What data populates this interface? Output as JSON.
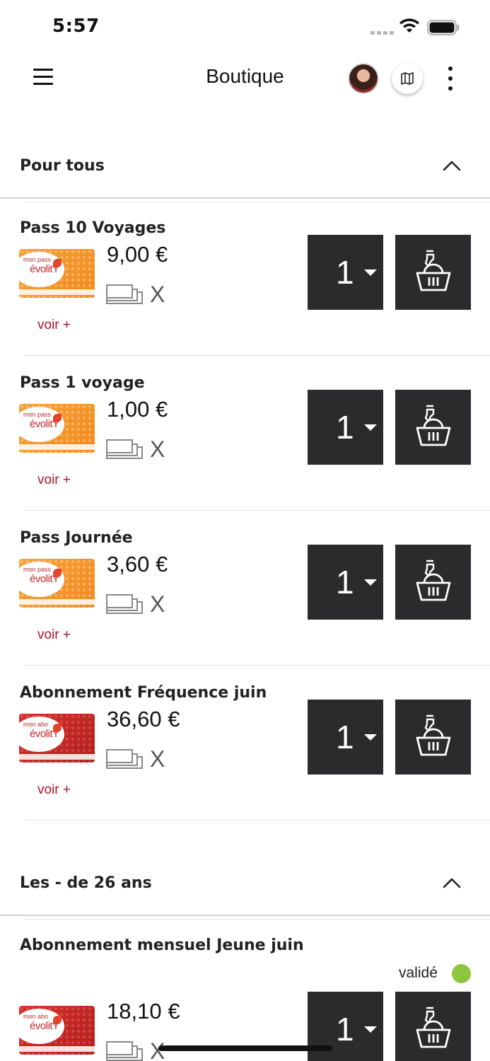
{
  "status_bar": {
    "time": "5:57"
  },
  "header": {
    "title": "Boutique",
    "menu_icon": "hamburger-icon",
    "map_icon": "map-icon",
    "more_icon": "more-vertical-icon"
  },
  "sections": [
    {
      "title": "Pour tous",
      "products": [
        {
          "name": "Pass 10 Voyages",
          "price": "9,00 €",
          "card": "mon pass évolitY",
          "card_brand_top": "mon pass",
          "card_brand": "évolitY",
          "multiplier": "X",
          "see_more": "voir +",
          "quantity": "1"
        },
        {
          "name": "Pass 1 voyage",
          "price": "1,00 €",
          "card": "mon pass évolitY",
          "card_brand_top": "mon pass",
          "card_brand": "évolitY",
          "multiplier": "X",
          "see_more": "voir +",
          "quantity": "1"
        },
        {
          "name": "Pass Journée",
          "price": "3,60 €",
          "card": "mon pass évolitY",
          "card_brand_top": "mon pass",
          "card_brand": "évolitY",
          "multiplier": "X",
          "see_more": "voir +",
          "quantity": "1"
        },
        {
          "name": "Abonnement Fréquence juin",
          "price": "36,60 €",
          "card": "mon abo évolitY",
          "card_brand_top": "mon abo",
          "card_brand": "évolitY",
          "multiplier": "X",
          "see_more": "voir +",
          "quantity": "1"
        }
      ]
    },
    {
      "title": "Les - de 26 ans",
      "products": [
        {
          "name": "Abonnement mensuel Jeune juin",
          "price": "18,10 €",
          "card": "mon abo évolitY",
          "card_brand_top": "mon abo",
          "card_brand": "évolitY",
          "multiplier": "X",
          "quantity": "1",
          "status": "validé"
        }
      ]
    }
  ],
  "colors": {
    "button_bg": "#2b2b2d",
    "link": "#b0132a",
    "status_ok": "#8cc63f",
    "card_orange": "#f39a2b",
    "card_red": "#c8262a"
  }
}
